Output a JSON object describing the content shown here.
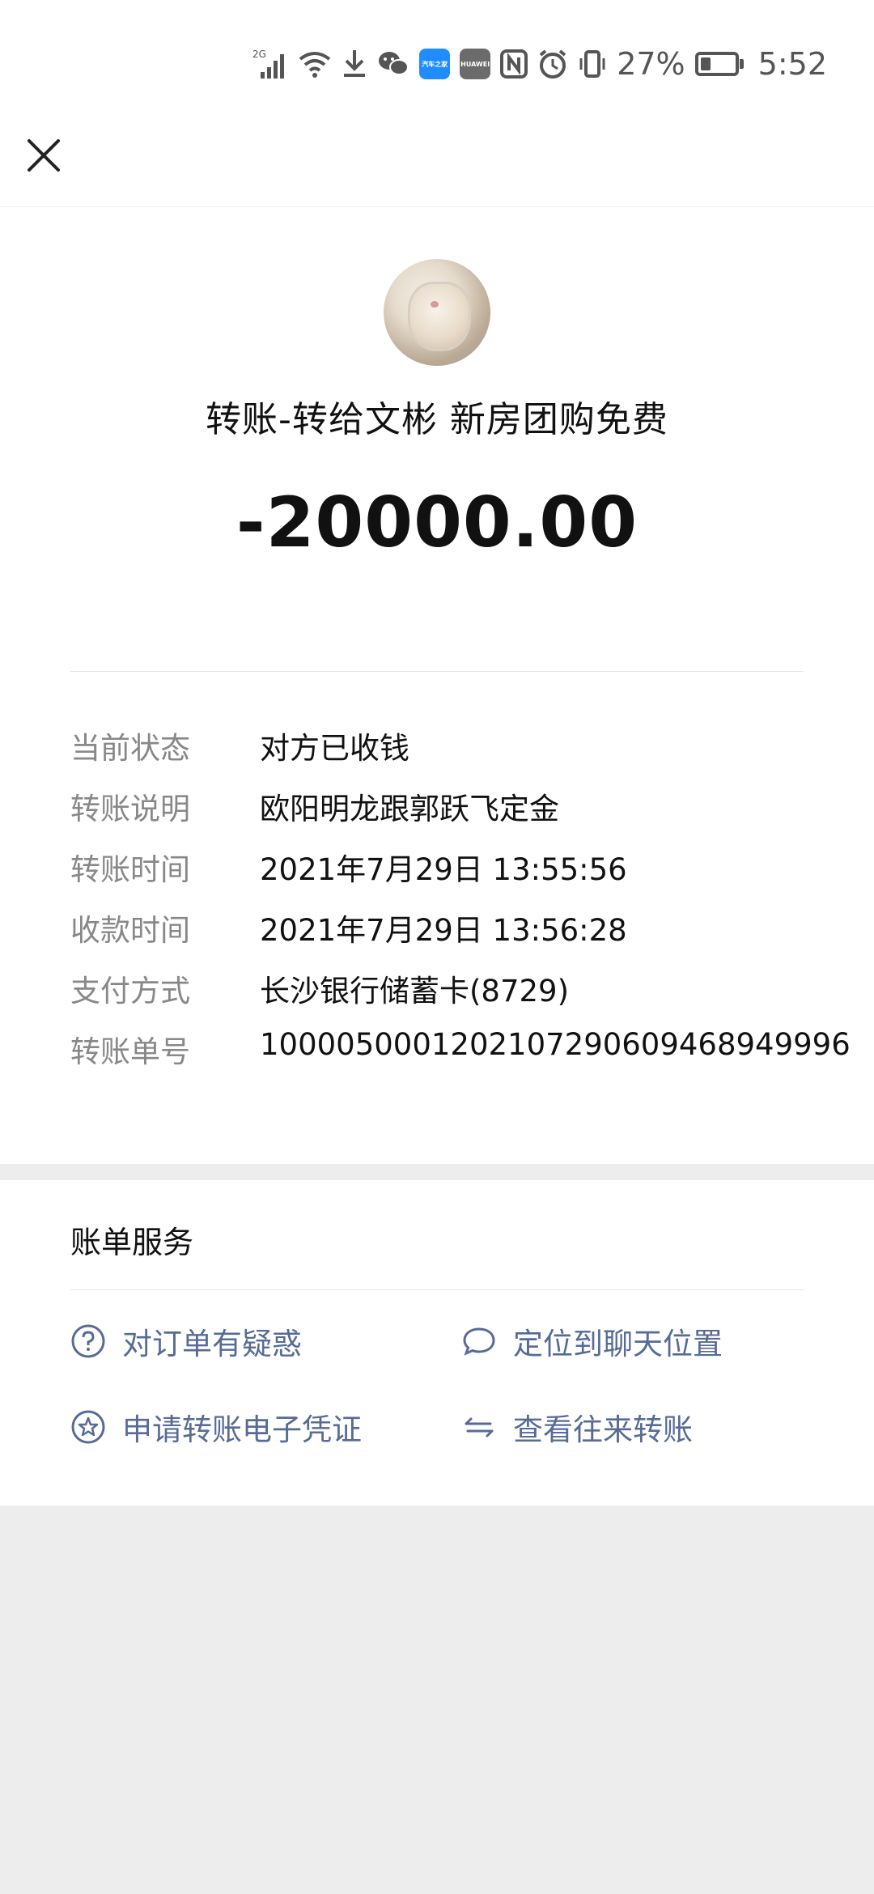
{
  "status_bar": {
    "network_label": "2G",
    "app_badge_1": "汽车之家",
    "app_badge_2": "HUAWEI",
    "battery": "27%",
    "time": "5:52"
  },
  "header": {
    "close_icon": "close-icon"
  },
  "hero": {
    "title": "转账-转给文彬 新房团购免费",
    "amount": "-20000.00"
  },
  "details": [
    {
      "label": "当前状态",
      "value": "对方已收钱"
    },
    {
      "label": "转账说明",
      "value": "欧阳明龙跟郭跃飞定金"
    },
    {
      "label": "转账时间",
      "value": "2021年7月29日 13:55:56"
    },
    {
      "label": "收款时间",
      "value": "2021年7月29日 13:56:28"
    },
    {
      "label": "支付方式",
      "value": "长沙银行储蓄卡(8729)"
    },
    {
      "label": "转账单号",
      "value": "100005000120210729060946894​9996"
    }
  ],
  "services": {
    "title": "账单服务",
    "items": [
      {
        "label": "对订单有疑惑",
        "icon": "question-circle-icon"
      },
      {
        "label": "定位到聊天位置",
        "icon": "chat-bubble-icon"
      },
      {
        "label": "申请转账电子凭证",
        "icon": "star-circle-icon"
      },
      {
        "label": "查看往来转账",
        "icon": "exchange-arrows-icon"
      }
    ]
  },
  "colors": {
    "link": "#576b95",
    "label_gray": "#888888",
    "background": "#ededed"
  }
}
